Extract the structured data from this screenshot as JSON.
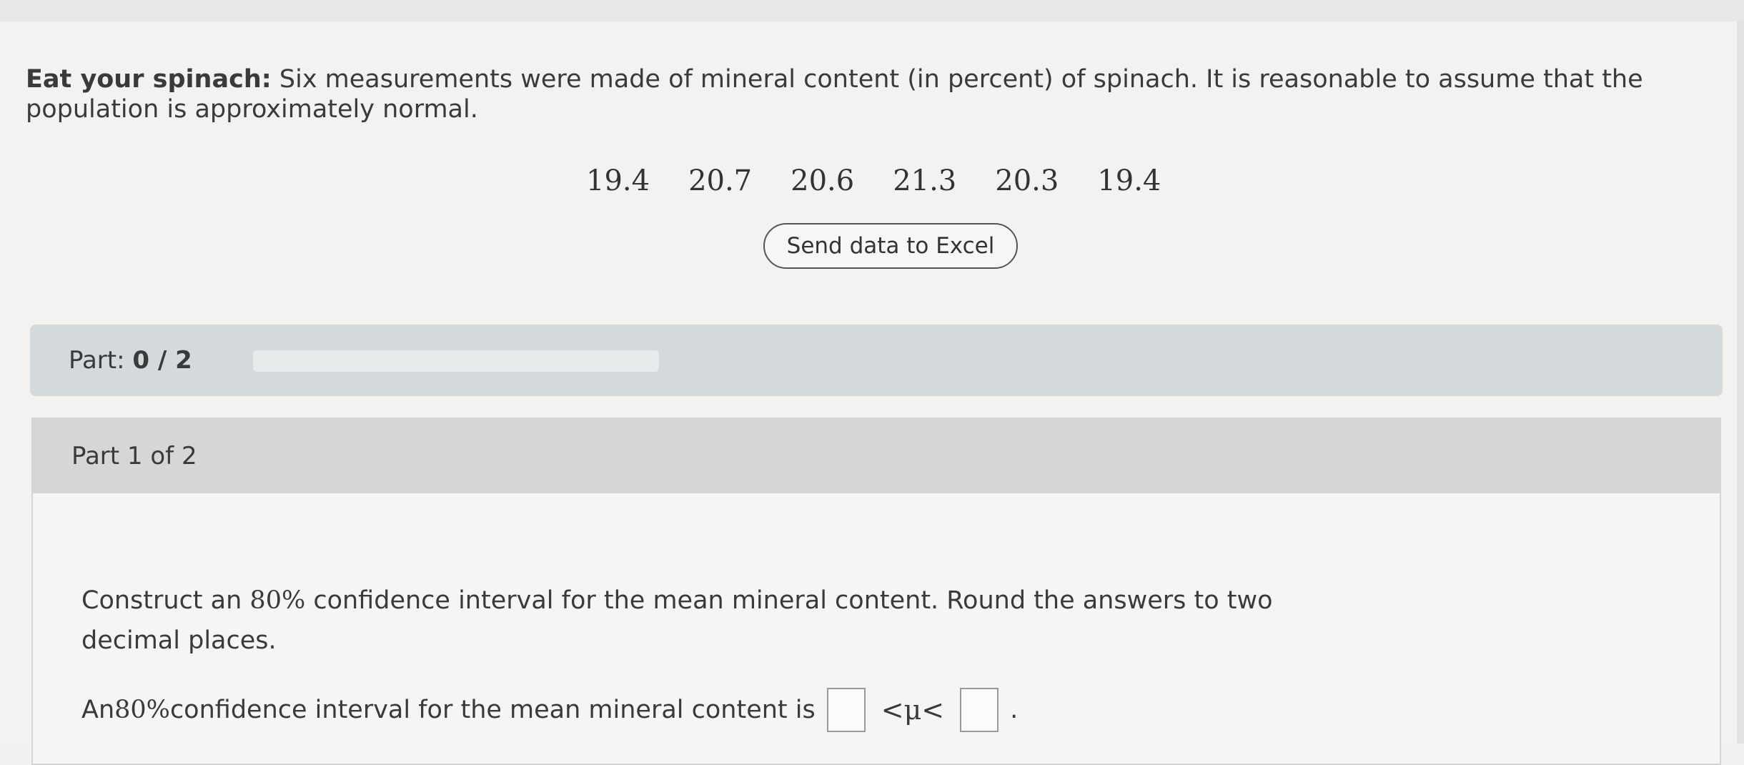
{
  "intro": {
    "title": "Eat your spinach:",
    "text": "Six measurements were made of mineral content (in percent) of spinach. It is reasonable to assume that the population is approximately normal."
  },
  "data_values": [
    "19.4",
    "20.7",
    "20.6",
    "21.3",
    "20.3",
    "19.4"
  ],
  "excel_button": {
    "label": "Send data to Excel"
  },
  "progress": {
    "label": "Part:",
    "value": "0 / 2",
    "fraction": 0
  },
  "part": {
    "header": "Part 1 of 2",
    "question_part1": "Construct an ",
    "question_pct": "80%",
    "question_part2": " confidence interval for the mean mineral content. Round the answers to two decimal places.",
    "answer_prefix": "An ",
    "answer_pct": "80%",
    "answer_mid": " confidence interval for the mean mineral content is",
    "mu_expr": "<μ<",
    "answer_suffix": "."
  },
  "colors": {
    "progress_bar_bg": "#d4dadc",
    "part_header_bg": "#d5d7d6"
  }
}
